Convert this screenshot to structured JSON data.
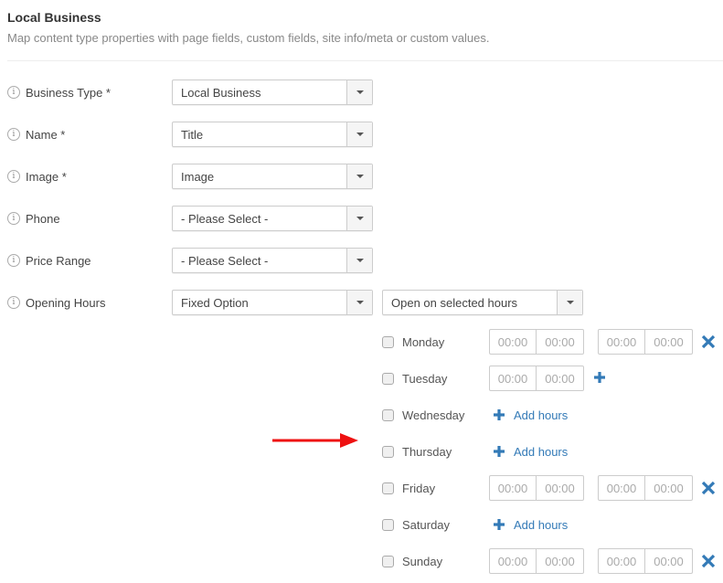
{
  "header": {
    "title": "Local Business",
    "subtitle": "Map content type properties with page fields, custom fields, site info/meta or custom values."
  },
  "fields": [
    {
      "label": "Business Type *",
      "value": "Local Business"
    },
    {
      "label": "Name *",
      "value": "Title"
    },
    {
      "label": "Image *",
      "value": "Image"
    },
    {
      "label": "Phone",
      "value": "- Please Select -"
    },
    {
      "label": "Price Range",
      "value": "- Please Select -"
    },
    {
      "label": "Opening Hours",
      "value": "Fixed Option",
      "secondary_value": "Open on selected hours"
    }
  ],
  "info_icon_glyph": "i",
  "time_placeholder": "00:00",
  "add_hours_label": "Add hours",
  "days": [
    {
      "name": "Monday",
      "checked": false,
      "slots": 2
    },
    {
      "name": "Tuesday",
      "checked": false,
      "slots": 1
    },
    {
      "name": "Wednesday",
      "checked": false,
      "slots": 0
    },
    {
      "name": "Thursday",
      "checked": false,
      "slots": 0
    },
    {
      "name": "Friday",
      "checked": false,
      "slots": 2
    },
    {
      "name": "Saturday",
      "checked": false,
      "slots": 0
    },
    {
      "name": "Sunday",
      "checked": false,
      "slots": 2
    }
  ],
  "colors": {
    "accent": "#337ab7",
    "annotation_arrow": "#ee1111"
  }
}
